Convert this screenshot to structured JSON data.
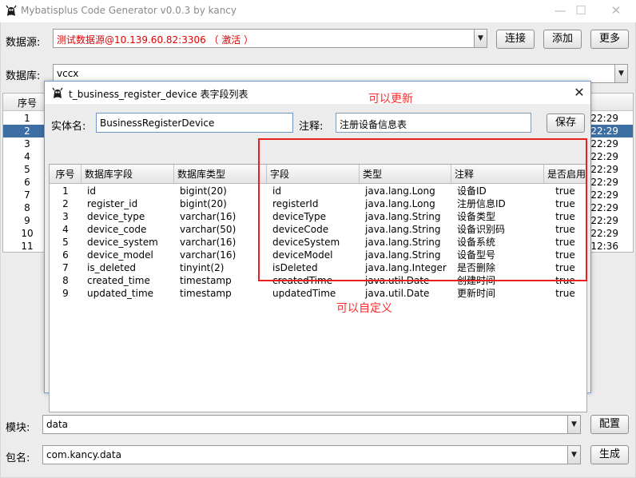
{
  "window": {
    "title": "Mybatisplus Code Generator v0.0.3 by kancy"
  },
  "datasource": {
    "label": "数据源:",
    "value": "测试数据源@10.139.60.82:3306 （ 激活 ）",
    "value_color": "#e00000"
  },
  "buttons": {
    "connect": "连接",
    "add": "添加",
    "more": "更多",
    "config": "配置",
    "generate": "生成",
    "save": "保存"
  },
  "database": {
    "label": "数据库:",
    "value": "vccx"
  },
  "background_table": {
    "header": "序号",
    "rows": [
      {
        "n": "1",
        "time": "22:29"
      },
      {
        "n": "2",
        "time": "22:29",
        "selected": true
      },
      {
        "n": "3",
        "time": "22:29"
      },
      {
        "n": "4",
        "time": "22:29"
      },
      {
        "n": "5",
        "time": "22:29"
      },
      {
        "n": "6",
        "time": "22:29"
      },
      {
        "n": "7",
        "time": "22:29"
      },
      {
        "n": "8",
        "time": "22:29"
      },
      {
        "n": "9",
        "time": "22:29"
      },
      {
        "n": "10",
        "time": "22:29"
      },
      {
        "n": "11",
        "time": "12:36"
      }
    ]
  },
  "module": {
    "label": "模块:",
    "value": "data"
  },
  "package": {
    "label": "包名:",
    "value": "com.kancy.data"
  },
  "dialog": {
    "title": "t_business_register_device 表字段列表",
    "entity_label": "实体名:",
    "entity_value": "BusinessRegisterDevice",
    "comment_label": "注释:",
    "comment_value": "注册设备信息表",
    "columns": [
      "序号",
      "数据库字段",
      "数据库类型",
      "字段",
      "类型",
      "注释",
      "是否启用"
    ],
    "rows": [
      [
        "1",
        "id",
        "bigint(20)",
        "id",
        "java.lang.Long",
        "设备ID",
        "true"
      ],
      [
        "2",
        "register_id",
        "bigint(20)",
        "registerId",
        "java.lang.Long",
        "注册信息ID",
        "true"
      ],
      [
        "3",
        "device_type",
        "varchar(16)",
        "deviceType",
        "java.lang.String",
        "设备类型",
        "true"
      ],
      [
        "4",
        "device_code",
        "varchar(50)",
        "deviceCode",
        "java.lang.String",
        "设备识别码",
        "true"
      ],
      [
        "5",
        "device_system",
        "varchar(16)",
        "deviceSystem",
        "java.lang.String",
        "设备系统",
        "true"
      ],
      [
        "6",
        "device_model",
        "varchar(16)",
        "deviceModel",
        "java.lang.String",
        "设备型号",
        "true"
      ],
      [
        "7",
        "is_deleted",
        "tinyint(2)",
        "isDeleted",
        "java.lang.Integer",
        "是否删除",
        "true"
      ],
      [
        "8",
        "created_time",
        "timestamp",
        "createdTime",
        "java.util.Date",
        "创建时间",
        "true"
      ],
      [
        "9",
        "updated_time",
        "timestamp",
        "updatedTime",
        "java.util.Date",
        "更新时间",
        "true"
      ]
    ]
  },
  "annotations": {
    "updatable": "可以更新",
    "customizable": "可以自定义",
    "color": "#e8201e"
  },
  "icons": {
    "app": "mascot-icon",
    "minimize": "minimize-icon",
    "maximize": "maximize-icon",
    "close": "close-icon",
    "dropdown": "chevron-down-icon"
  }
}
